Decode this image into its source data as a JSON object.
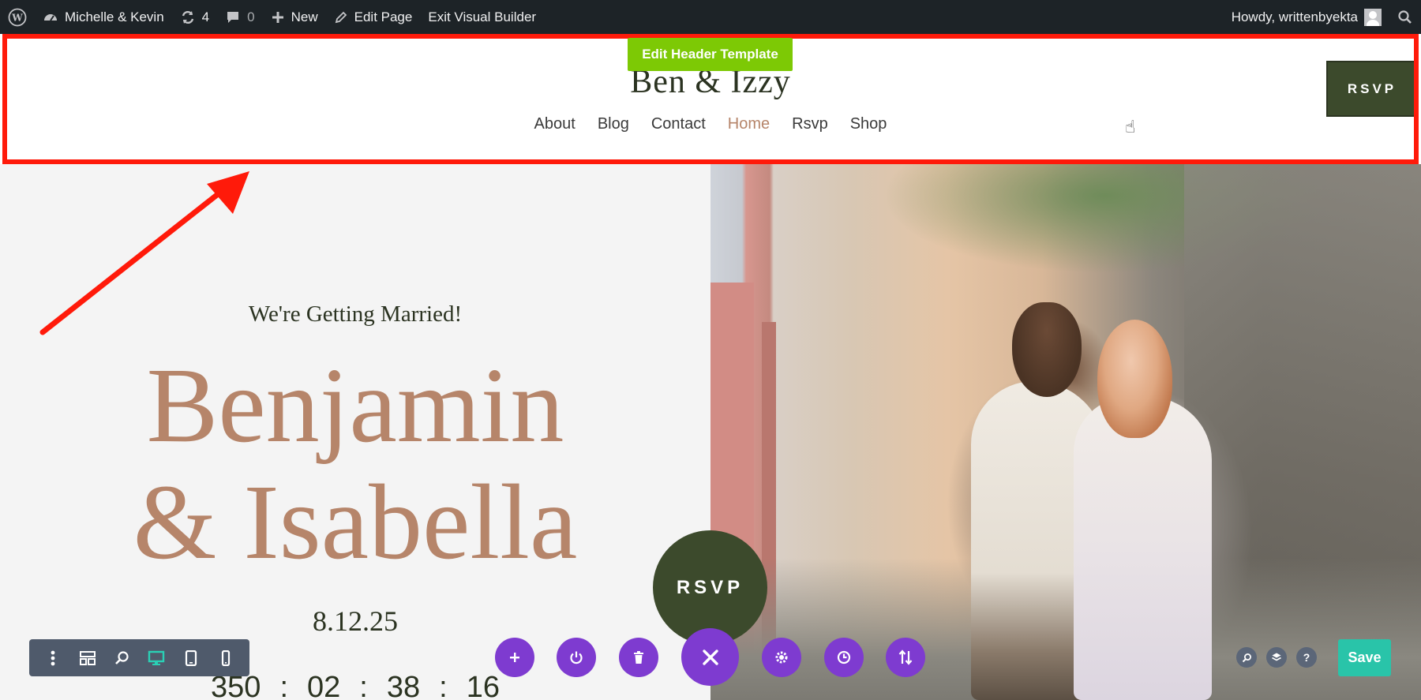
{
  "adminbar": {
    "site_name": "Michelle & Kevin",
    "updates_count": "4",
    "comments_count": "0",
    "new_label": "New",
    "edit_page_label": "Edit Page",
    "exit_builder_label": "Exit Visual Builder",
    "howdy_label": "Howdy, writtenbyekta"
  },
  "header": {
    "edit_tab_label": "Edit Header Template",
    "site_title": "Ben & Izzy",
    "nav": [
      "About",
      "Blog",
      "Contact",
      "Home",
      "Rsvp",
      "Shop"
    ],
    "active_nav": "Home",
    "rsvp_label": "RSVP"
  },
  "hero": {
    "tagline": "We're Getting Married!",
    "name_line1": "Benjamin",
    "name_line2": "& Isabella",
    "date": "8.12.25",
    "countdown": [
      "350",
      "02",
      "38",
      "16"
    ],
    "rsvp_label": "RSVP"
  },
  "builder": {
    "save_label": "Save",
    "help_label": "?"
  },
  "colors": {
    "accent_green": "#3c4a2c",
    "rose": "#b6856a",
    "header_tab": "#7dc905",
    "highlight": "#ff1a0a",
    "purple": "#7e3bd0",
    "save": "#29c4a9"
  },
  "icons": {
    "admin": [
      "wordpress-icon",
      "dashboard-icon",
      "updates-icon",
      "comments-icon",
      "plus-icon",
      "pencil-icon",
      "search-icon"
    ],
    "builder_left": [
      "more-icon",
      "layout-icon",
      "zoom-icon",
      "desktop-icon",
      "tablet-icon",
      "phone-icon"
    ],
    "builder_center": [
      "add-icon",
      "power-icon",
      "trash-icon",
      "close-icon",
      "settings-icon",
      "history-icon",
      "sort-icon"
    ],
    "builder_right": [
      "search-icon",
      "layers-icon",
      "help-icon"
    ]
  }
}
